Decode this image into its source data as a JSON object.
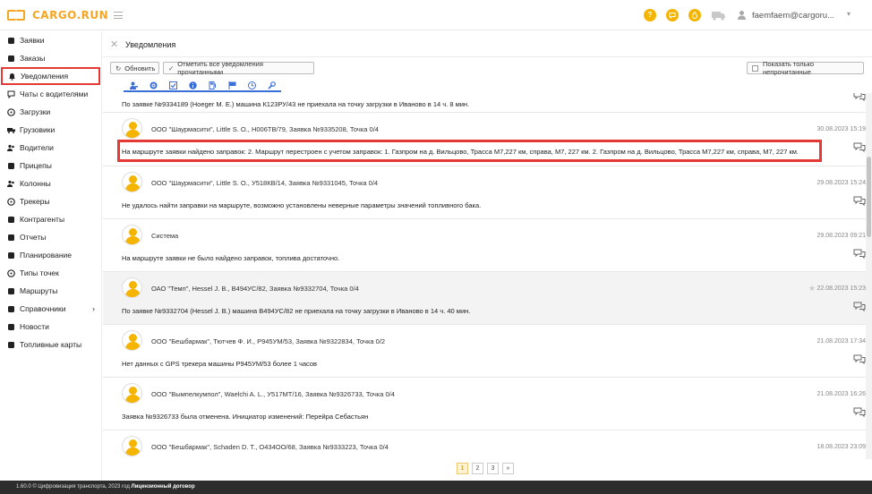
{
  "app": {
    "logo_text": "CARGO.RUN",
    "brand_color": "#f5a623",
    "user_name": "faemfaem@cargoru..."
  },
  "top_icons": [
    "help-icon",
    "chat-icon",
    "fuel-icon",
    "truck-icon",
    "user-icon"
  ],
  "sidebar": {
    "items": [
      {
        "label": "Заявки",
        "icon": "document-icon"
      },
      {
        "label": "Заказы",
        "icon": "document-icon"
      },
      {
        "label": "Уведомления",
        "icon": "bell-icon"
      },
      {
        "label": "Чаты с водителями",
        "icon": "chat-icon"
      },
      {
        "label": "Загрузки",
        "icon": "clock-icon"
      },
      {
        "label": "Грузовики",
        "icon": "truck-icon"
      },
      {
        "label": "Водители",
        "icon": "people-icon"
      },
      {
        "label": "Прицепы",
        "icon": "trailer-icon"
      },
      {
        "label": "Колонны",
        "icon": "group-icon"
      },
      {
        "label": "Трекеры",
        "icon": "location-icon"
      },
      {
        "label": "Контрагенты",
        "icon": "handshake-icon"
      },
      {
        "label": "Отчеты",
        "icon": "report-icon"
      },
      {
        "label": "Планирование",
        "icon": "calendar-icon"
      },
      {
        "label": "Типы точек",
        "icon": "pin-icon"
      },
      {
        "label": "Маршруты",
        "icon": "route-icon"
      },
      {
        "label": "Справочники",
        "icon": "book-icon"
      },
      {
        "label": "Новости",
        "icon": "news-icon"
      },
      {
        "label": "Топливные карты",
        "icon": "card-icon"
      }
    ]
  },
  "page": {
    "title": "Уведомления",
    "refresh_label": "Обновить",
    "mark_all_read_label": "Отметить все уведомления прочитанными",
    "unread_only_label": "Показать только непрочитанные"
  },
  "filter_tabs": [
    "driver-icon",
    "gear-icon",
    "checklist-icon",
    "info-icon",
    "fuel-pump-icon",
    "flag-icon",
    "clock-icon",
    "wrench-icon"
  ],
  "notifications": [
    {
      "sender": "",
      "date": "",
      "message": "По заявке №9334189 (Hoeger M. E.) машина К123РУ/43 не приехала на точку загрузки в Иваново в 14 ч. 8 мин."
    },
    {
      "sender": "ООО \"Шаурмасити\", Little S. O., Н006ТВ/79, Заявка №9335208, Точка 0/4",
      "date": "30.08.2023 15:19",
      "message": "На маршруте заявки найдено заправок: 2. Маршрут перестроен с учетом заправок: 1. Газпром на д. Вильцово, Трасса М7,227 км, справа, М7, 227 км. 2. Газпром на д. Вильцово, Трасса М7,227 км, справа, М7, 227 км."
    },
    {
      "sender": "ООО \"Шаурмасити\", Little S. O., У518КВ/14, Заявка №9331045, Точка 0/4",
      "date": "29.08.2023 15:24",
      "message": "Не удалось найти заправки на маршруте, возможно установлены неверные параметры значений топливного бака."
    },
    {
      "sender": "Система",
      "date": "29.08.2023 09:21",
      "message": "На маршруте заявки не было найдено заправок, топлива достаточно."
    },
    {
      "sender": "ОАО \"Темп\", Hessel J. B., В494УС/82, Заявка №9332704, Точка 0/4",
      "date": "22.08.2023 15:23",
      "message": "По заявке №9332704 (Hessel J. B.) машина В494УС/82 не приехала на точку загрузки в Иваново в 14 ч. 40 мин."
    },
    {
      "sender": "ООО \"Бешбармак\", Тютчев Ф. И., Р945УМ/53, Заявка №9322834, Точка 0/2",
      "date": "21.08.2023 17:34",
      "message": "Нет данных с GPS трекера машины Р945УМ/53 более 1 часов"
    },
    {
      "sender": "ООО \"Вымпелкумпол\", Waelchi A. L., У517МТ/16, Заявка №9326733, Точка 0/4",
      "date": "21.08.2023 16:26",
      "message": "Заявка №9326733 была отменена. Инициатор изменений: Перейра Себастьян"
    },
    {
      "sender": "ООО \"Бешбармак\", Schaden D. T., О434ОО/68, Заявка №9333223, Точка 0/4",
      "date": "18.08.2023 23:09",
      "message": ""
    }
  ],
  "pagination": [
    "1",
    "2",
    "3",
    "»"
  ],
  "footer": {
    "text": "1.60.0 © Цифровизация транспорта, 2023 год",
    "license": "Лицензионный договор"
  }
}
